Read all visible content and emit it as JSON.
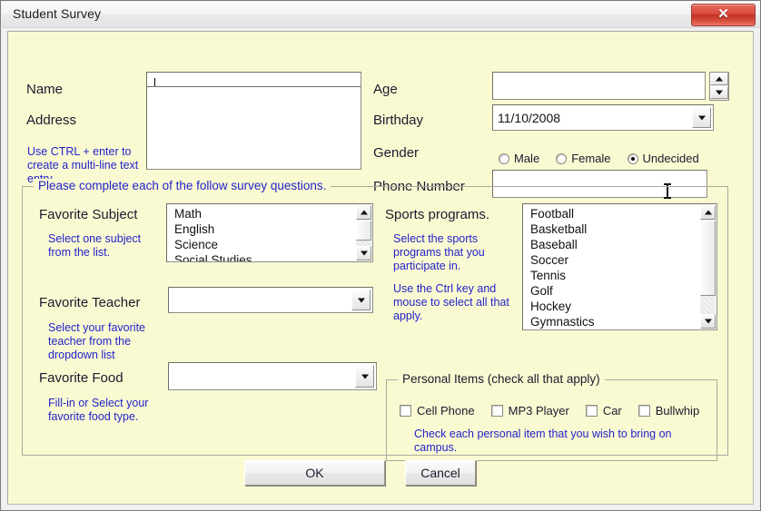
{
  "window": {
    "title": "Student Survey",
    "close_label": "✕"
  },
  "form": {
    "name": {
      "label": "Name",
      "value": "",
      "placeholder": ""
    },
    "address": {
      "label": "Address",
      "value": "",
      "hint": "Use CTRL + enter to create a multi-line text entry"
    },
    "age": {
      "label": "Age",
      "value": "",
      "spinner_up": "▲",
      "spinner_down": "▼"
    },
    "birthday": {
      "label": "Birthday",
      "value": "11/10/2008"
    },
    "gender": {
      "label": "Gender",
      "options": [
        {
          "label": "Male",
          "selected": false
        },
        {
          "label": "Female",
          "selected": false
        },
        {
          "label": "Undecided",
          "selected": true
        }
      ]
    },
    "phone": {
      "label": "Phone Number",
      "value": ""
    }
  },
  "survey_group": {
    "legend": "Please complete each of the follow survey questions.",
    "favorite_subject": {
      "label": "Favorite Subject",
      "hint": "Select one subject from the list.",
      "items": [
        "Math",
        "English",
        "Science",
        "Social Studies"
      ]
    },
    "favorite_teacher": {
      "label": "Favorite Teacher",
      "hint": "Select your favorite teacher from the dropdown list",
      "value": ""
    },
    "favorite_food": {
      "label": "Favorite Food",
      "hint": "Fill-in or Select your favorite food type.",
      "value": ""
    },
    "sports": {
      "label": "Sports programs.",
      "hint1": "Select the sports programs that you participate in.",
      "hint2": "Use the Ctrl key and mouse to select all that apply.",
      "items": [
        "Football",
        "Basketball",
        "Baseball",
        "Soccer",
        "Tennis",
        "Golf",
        "Hockey",
        "Gymnastics"
      ]
    },
    "personal_items": {
      "legend": "Personal Items (check all that apply)",
      "hint": "Check each personal item that you wish to bring on campus.",
      "items": [
        {
          "label": "Cell Phone",
          "checked": false
        },
        {
          "label": "MP3 Player",
          "checked": false
        },
        {
          "label": "Car",
          "checked": false
        },
        {
          "label": "Bullwhip",
          "checked": false
        }
      ]
    }
  },
  "buttons": {
    "ok": "OK",
    "cancel": "Cancel"
  },
  "colors": {
    "client_background": "#fafad2",
    "hint_text": "#2222cc",
    "label_text": "#1a1a2e",
    "close_button": "#c03022"
  }
}
